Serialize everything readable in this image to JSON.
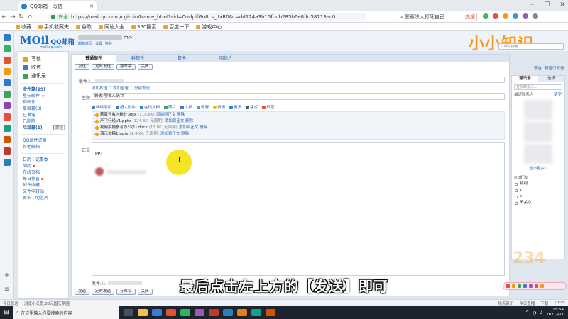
{
  "browser": {
    "tab_title": "QQ邮箱 - 写信",
    "url_secure": "安全",
    "url": "https://mail.qq.com/cgi-bin/frame_html?sid=QvdpifGo8cs_ltxR0&r=dd124a3b15fbdb285b6e8ffd58713ec0",
    "search_text": "警察法大打死自己",
    "search_hot": "热搜",
    "bookmarks": [
      "收藏",
      "手机收藏夹",
      "谷歌",
      "网址大全",
      "360搜索",
      "百度一下",
      "游戏中心"
    ]
  },
  "mail_header": {
    "logo_main": "MOil",
    "logo_sub": "QQ邮箱",
    "logo_domain": "mail.qq.com",
    "account_suffix": "m>",
    "account_links": [
      "邮箱首页",
      "设置",
      "换肤"
    ],
    "brand": "小小知识234",
    "search_placeholder": "邮件搜索"
  },
  "nav": {
    "actions": [
      {
        "label": "写信",
        "color": "#e2a21d"
      },
      {
        "label": "收信",
        "color": "#3a7bd5"
      },
      {
        "label": "通讯录",
        "color": "#3aa45c"
      }
    ],
    "folders1": [
      {
        "label": "收件箱(29)",
        "bold": true,
        "extra": ""
      },
      {
        "label": "星标邮件",
        "bold": false,
        "extra": "★"
      },
      {
        "label": "群邮件",
        "bold": false,
        "extra": ""
      },
      {
        "label": "草稿箱(3)",
        "bold": false,
        "extra": ""
      },
      {
        "label": "已发送",
        "bold": false,
        "extra": ""
      },
      {
        "label": "已删除",
        "bold": false,
        "extra": ""
      },
      {
        "label": "垃圾箱(1)",
        "bold": true,
        "extra": "[清空]"
      }
    ],
    "folders2": [
      "QQ邮件订阅",
      "其他邮箱"
    ],
    "folders3": [
      {
        "label": "日历 | 记事本",
        "dot": false
      },
      {
        "label": "简历",
        "dot": true
      },
      {
        "label": "在线文档",
        "dot": false
      },
      {
        "label": "每日惊喜",
        "dot": true
      },
      {
        "label": "附件收藏",
        "dot": false
      },
      {
        "label": "文件中转站",
        "dot": false
      },
      {
        "label": "贺卡 | 明信片",
        "dot": false
      }
    ]
  },
  "compose": {
    "tabs": [
      "普通邮件",
      "群邮件",
      "贺卡",
      "明信片"
    ],
    "commands": [
      "发送",
      "定时发送",
      "存草稿",
      "关闭"
    ],
    "recipient_label": "收件人",
    "recipient_links": [
      "添加抄送",
      "添加密送",
      "分别发送"
    ],
    "subject_label": "主题",
    "subject_value": "薪家号收入统计",
    "toolbar": [
      "继续添加",
      "超大附件",
      "在线文档",
      "照片",
      "文档",
      "截屏",
      "表情",
      "更多",
      "格式",
      "日程"
    ],
    "attachments": [
      {
        "name": "薪家号收入统计.xlsx",
        "size": "(118.6K)",
        "actions": "添加到正文  删除"
      },
      {
        "name": "产飞行经V1.pptx",
        "size": "(124.8K, 无限期)",
        "actions": "添加到正文  删除"
      },
      {
        "name": "视频拍摄参写办公(1).docx",
        "size": "(13.8K, 无限期)",
        "actions": "添加到正文  删除"
      },
      {
        "name": "演示文稿1.pptx",
        "size": "(1.40M, 无限期)",
        "actions": "添加到正文  删除"
      }
    ],
    "body_label": "正文",
    "body_text": "PPT",
    "sender_label": "发件人:"
  },
  "right_panel": {
    "links": [
      "预告",
      "新窗口写信"
    ],
    "tabs": [
      "通讯录",
      "信纸"
    ],
    "search_placeholder": "查找联系人...",
    "recent_label": "最近联系人",
    "recent_clear": "清空",
    "show_more": "显示更多1",
    "qq_label": "QQ好友",
    "qq_items": [
      "特别",
      "z",
      "s",
      "不关心"
    ]
  },
  "subtitle": "最后点击左上方的【发送】即可",
  "statusbar": {
    "left": [
      "今日优选",
      "浏览小长假,88元国庆氛围"
    ],
    "right": [
      "热点资讯",
      "今日直播",
      "下载",
      "100%"
    ]
  },
  "taskbar": {
    "search_placeholder": "在这里输入你要搜索的内容",
    "clock_time": "15:54",
    "clock_date": "2021/4/7"
  },
  "colors": {
    "brand_orange": "#f29c1f",
    "link_blue": "#1e5fb0",
    "highlight_yellow": "#f5e000"
  }
}
